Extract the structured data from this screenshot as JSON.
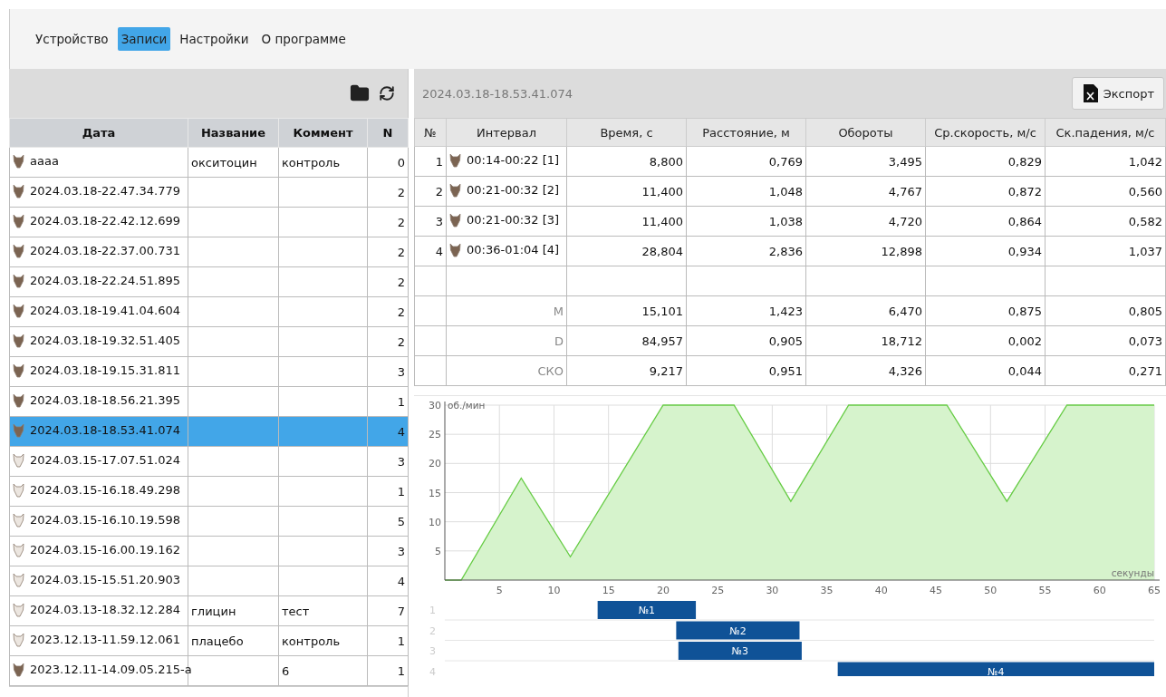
{
  "menu": [
    {
      "label": "Устройство",
      "selected": false
    },
    {
      "label": "Записи",
      "selected": true
    },
    {
      "label": "Настройки",
      "selected": false
    },
    {
      "label": "О программе",
      "selected": false
    }
  ],
  "records": {
    "columns": [
      "Дата",
      "Название",
      "Коммент",
      "N"
    ],
    "rows": [
      {
        "date": "аааа",
        "name": "окситоцин",
        "comment": "контроль",
        "n": "0",
        "kind": "dark",
        "selected": false
      },
      {
        "date": "2024.03.18-22.47.34.779",
        "n": "2",
        "kind": "dark",
        "selected": false
      },
      {
        "date": "2024.03.18-22.42.12.699",
        "n": "2",
        "kind": "dark",
        "selected": false
      },
      {
        "date": "2024.03.18-22.37.00.731",
        "n": "2",
        "kind": "dark",
        "selected": false
      },
      {
        "date": "2024.03.18-22.24.51.895",
        "n": "2",
        "kind": "dark",
        "selected": false
      },
      {
        "date": "2024.03.18-19.41.04.604",
        "n": "2",
        "kind": "dark",
        "selected": false
      },
      {
        "date": "2024.03.18-19.32.51.405",
        "n": "2",
        "kind": "dark",
        "selected": false
      },
      {
        "date": "2024.03.18-19.15.31.811",
        "n": "3",
        "kind": "dark",
        "selected": false
      },
      {
        "date": "2024.03.18-18.56.21.395",
        "n": "1",
        "kind": "dark",
        "selected": false
      },
      {
        "date": "2024.03.18-18.53.41.074",
        "n": "4",
        "kind": "dark",
        "selected": true
      },
      {
        "date": "2024.03.15-17.07.51.024",
        "n": "3",
        "kind": "light",
        "selected": false
      },
      {
        "date": "2024.03.15-16.18.49.298",
        "n": "1",
        "kind": "light",
        "selected": false
      },
      {
        "date": "2024.03.15-16.10.19.598",
        "n": "5",
        "kind": "light",
        "selected": false
      },
      {
        "date": "2024.03.15-16.00.19.162",
        "n": "3",
        "kind": "light",
        "selected": false
      },
      {
        "date": "2024.03.15-15.51.20.903",
        "n": "4",
        "kind": "light",
        "selected": false
      },
      {
        "date": "2024.03.13-18.32.12.284",
        "name": "глицин",
        "comment": "тест",
        "n": "7",
        "kind": "light",
        "selected": false
      },
      {
        "date": "2023.12.13-11.59.12.061",
        "name": "плацебо",
        "comment": "контроль",
        "n": "1",
        "kind": "light",
        "selected": false
      },
      {
        "date": "2023.12.11-14.09.05.215-a",
        "comment": "6",
        "n": "1",
        "kind": "dark",
        "selected": false
      }
    ]
  },
  "record_title": "2024.03.18-18.53.41.074",
  "export_button": "Экспорт",
  "intervals": {
    "columns": [
      "№",
      "Интервал",
      "Время, с",
      "Расстояние, м",
      "Обороты",
      "Ср.скорость, м/с",
      "Ск.падения, м/с"
    ],
    "rows": [
      {
        "kind": "interval",
        "num": "1",
        "label": "00:14-00:22 [1]",
        "values": [
          "8,800",
          "0,769",
          "3,495",
          "0,829",
          "1,042"
        ]
      },
      {
        "kind": "interval",
        "num": "2",
        "label": "00:21-00:32 [2]",
        "values": [
          "11,400",
          "1,048",
          "4,767",
          "0,872",
          "0,560"
        ]
      },
      {
        "kind": "interval",
        "num": "3",
        "label": "00:21-00:32 [3]",
        "values": [
          "11,400",
          "1,038",
          "4,720",
          "0,864",
          "0,582"
        ]
      },
      {
        "kind": "interval",
        "num": "4",
        "label": "00:36-01:04 [4]",
        "values": [
          "28,804",
          "2,836",
          "12,898",
          "0,934",
          "1,037"
        ]
      },
      {
        "kind": "blank"
      },
      {
        "kind": "stat",
        "label": "M",
        "values": [
          "15,101",
          "1,423",
          "6,470",
          "0,875",
          "0,805"
        ]
      },
      {
        "kind": "stat",
        "label": "D",
        "values": [
          "84,957",
          "0,905",
          "18,712",
          "0,002",
          "0,073"
        ]
      },
      {
        "kind": "stat",
        "label": "СКО",
        "values": [
          "9,217",
          "0,951",
          "4,326",
          "0,044",
          "0,271"
        ]
      }
    ]
  },
  "chart": {
    "chart_data": {
      "type": "area",
      "xlabel": "секунды",
      "ylabel": "об./мин",
      "x": [
        0,
        1.5,
        7,
        11.5,
        20,
        26.5,
        31.7,
        37,
        46,
        51.5,
        57,
        65
      ],
      "series": [
        {
          "color": "#66cc44",
          "values": [
            0,
            0,
            17.5,
            4,
            30,
            30,
            13.5,
            30,
            30,
            13.5,
            30,
            30
          ]
        }
      ],
      "grid": true,
      "xlim": [
        0,
        65
      ],
      "ylim": [
        0,
        30
      ],
      "xticks": [
        5,
        10,
        15,
        20,
        25,
        30,
        35,
        40,
        45,
        50,
        55,
        60,
        65
      ],
      "yticks": [
        5,
        10,
        15,
        20,
        25,
        30
      ]
    },
    "timeline": [
      {
        "row": "1",
        "label": "№1"
      },
      {
        "row": "2",
        "label": "№2"
      },
      {
        "row": "3",
        "label": "№3"
      },
      {
        "row": "4",
        "label": "№4"
      }
    ]
  }
}
